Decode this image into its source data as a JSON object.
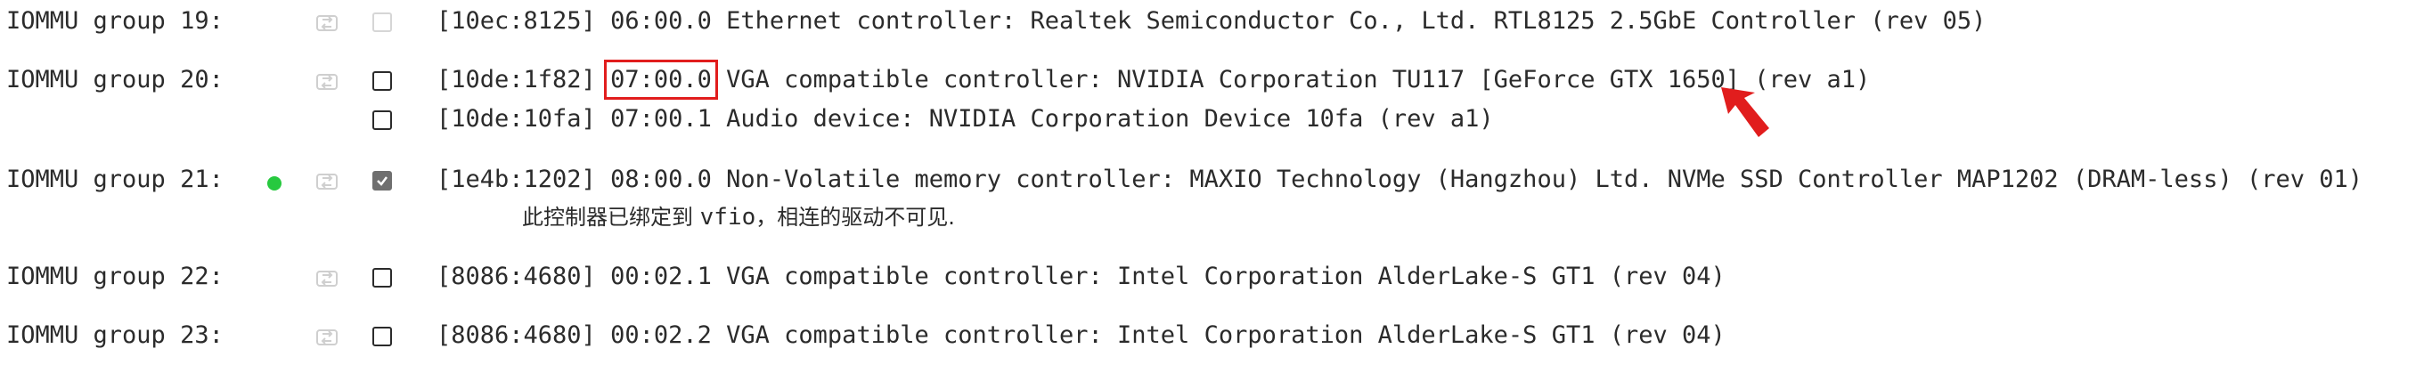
{
  "rows": [
    {
      "group": "IOMMU group 19:",
      "active": false,
      "checkbox_state": "disabled",
      "devices": [
        {
          "id": "[10ec:8125]",
          "bdf": "06:00.0",
          "desc": "Ethernet controller: Realtek Semiconductor Co., Ltd. RTL8125 2.5GbE Controller (rev 05)"
        }
      ]
    },
    {
      "group": "IOMMU group 20:",
      "active": false,
      "checkbox_state": "unchecked",
      "devices": [
        {
          "id": "[10de:1f82]",
          "bdf": "07:00.0",
          "desc": "VGA compatible controller: NVIDIA Corporation TU117 [GeForce GTX 1650] (rev a1)",
          "highlighted": true
        },
        {
          "id": "[10de:10fa]",
          "bdf": "07:00.1",
          "desc": "Audio device: NVIDIA Corporation Device 10fa (rev a1)"
        }
      ]
    },
    {
      "group": "IOMMU group 21:",
      "active": true,
      "checkbox_state": "checked",
      "devices": [
        {
          "id": "[1e4b:1202]",
          "bdf": "08:00.0",
          "desc": "Non-Volatile memory controller: MAXIO Technology (Hangzhou) Ltd. NVMe SSD Controller MAP1202 (DRAM-less) (rev 01)"
        }
      ],
      "note_prefix": "此控制器已绑定到 ",
      "note_driver": "vfio",
      "note_suffix": "，相连的驱动不可见."
    },
    {
      "group": "IOMMU group 22:",
      "active": false,
      "checkbox_state": "unchecked",
      "devices": [
        {
          "id": "[8086:4680]",
          "bdf": "00:02.1",
          "desc": "VGA compatible controller: Intel Corporation AlderLake-S GT1 (rev 04)"
        }
      ]
    },
    {
      "group": "IOMMU group 23:",
      "active": false,
      "checkbox_state": "unchecked",
      "devices": [
        {
          "id": "[8086:4680]",
          "bdf": "00:02.2",
          "desc": "VGA compatible controller: Intel Corporation AlderLake-S GT1 (rev 04)"
        }
      ]
    }
  ],
  "colors": {
    "text": "#2b2b2b",
    "active_dot": "#27c93f",
    "highlight": "#e11d1d"
  },
  "icons": {
    "reset": "reset-icon",
    "status": "status-dot",
    "annotation_arrow": "arrow-pointer-icon"
  }
}
